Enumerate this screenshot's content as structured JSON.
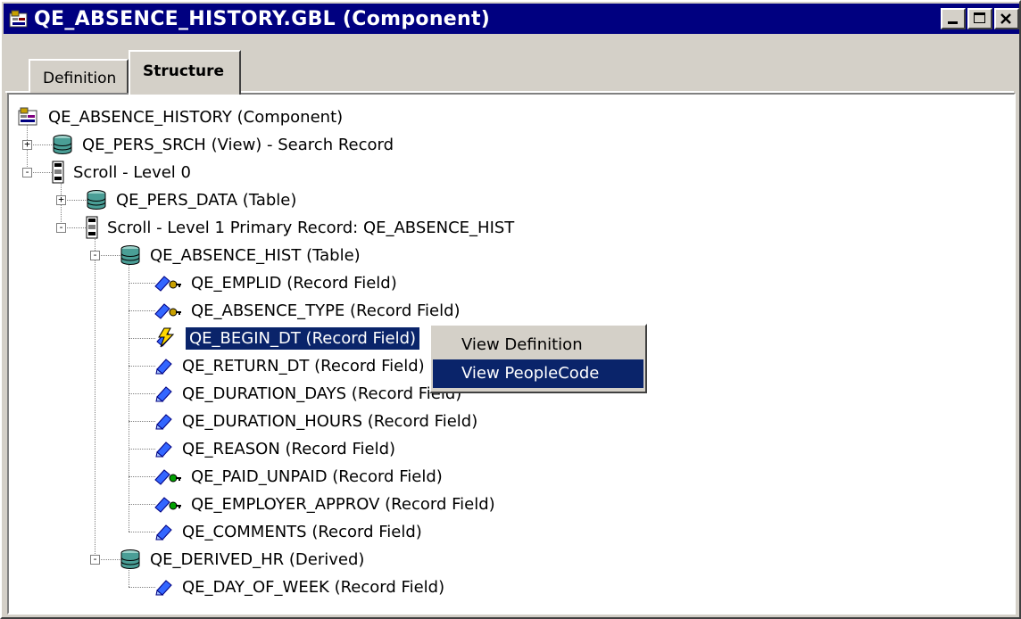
{
  "window": {
    "title": "QE_ABSENCE_HISTORY.GBL (Component)"
  },
  "tabs": [
    {
      "label": "Definition",
      "active": false
    },
    {
      "label": "Structure",
      "active": true
    }
  ],
  "tree": [
    {
      "label": "QE_ABSENCE_HISTORY (Component)",
      "icon": "component-icon"
    },
    {
      "label": "QE_PERS_SRCH (View) - Search Record",
      "icon": "record-icon",
      "expander": "+"
    },
    {
      "label": "Scroll - Level 0",
      "icon": "scroll-icon",
      "expander": "-"
    },
    {
      "label": "QE_PERS_DATA (Table)",
      "icon": "record-icon",
      "expander": "+"
    },
    {
      "label": "Scroll - Level 1  Primary Record: QE_ABSENCE_HIST",
      "icon": "scroll-icon",
      "expander": "-"
    },
    {
      "label": "QE_ABSENCE_HIST (Table)",
      "icon": "record-icon",
      "expander": "-"
    },
    {
      "label": "QE_EMPLID (Record Field)",
      "icon": "key-field-icon"
    },
    {
      "label": "QE_ABSENCE_TYPE (Record Field)",
      "icon": "key-field-icon"
    },
    {
      "label": "QE_BEGIN_DT (Record Field)",
      "icon": "peoplecode-field-icon",
      "selected": true
    },
    {
      "label": "QE_RETURN_DT (Record Field)",
      "icon": "field-icon"
    },
    {
      "label": "QE_DURATION_DAYS (Record Field)",
      "icon": "field-icon"
    },
    {
      "label": "QE_DURATION_HOURS (Record Field)",
      "icon": "field-icon"
    },
    {
      "label": "QE_REASON (Record Field)",
      "icon": "field-icon"
    },
    {
      "label": "QE_PAID_UNPAID (Record Field)",
      "icon": "alt-key-field-icon"
    },
    {
      "label": "QE_EMPLOYER_APPROV (Record Field)",
      "icon": "alt-key-field-icon"
    },
    {
      "label": "QE_COMMENTS (Record Field)",
      "icon": "field-icon"
    },
    {
      "label": "QE_DERIVED_HR (Derived)",
      "icon": "record-icon",
      "expander": "-"
    },
    {
      "label": "QE_DAY_OF_WEEK (Record Field)",
      "icon": "field-icon"
    }
  ],
  "context_menu": {
    "items": [
      {
        "label": "View Definition"
      },
      {
        "label": "View PeopleCode",
        "highlighted": true
      }
    ]
  },
  "colors": {
    "titlebar": "#000080",
    "selection": "#0a246a",
    "chrome": "#d4d0c8"
  }
}
